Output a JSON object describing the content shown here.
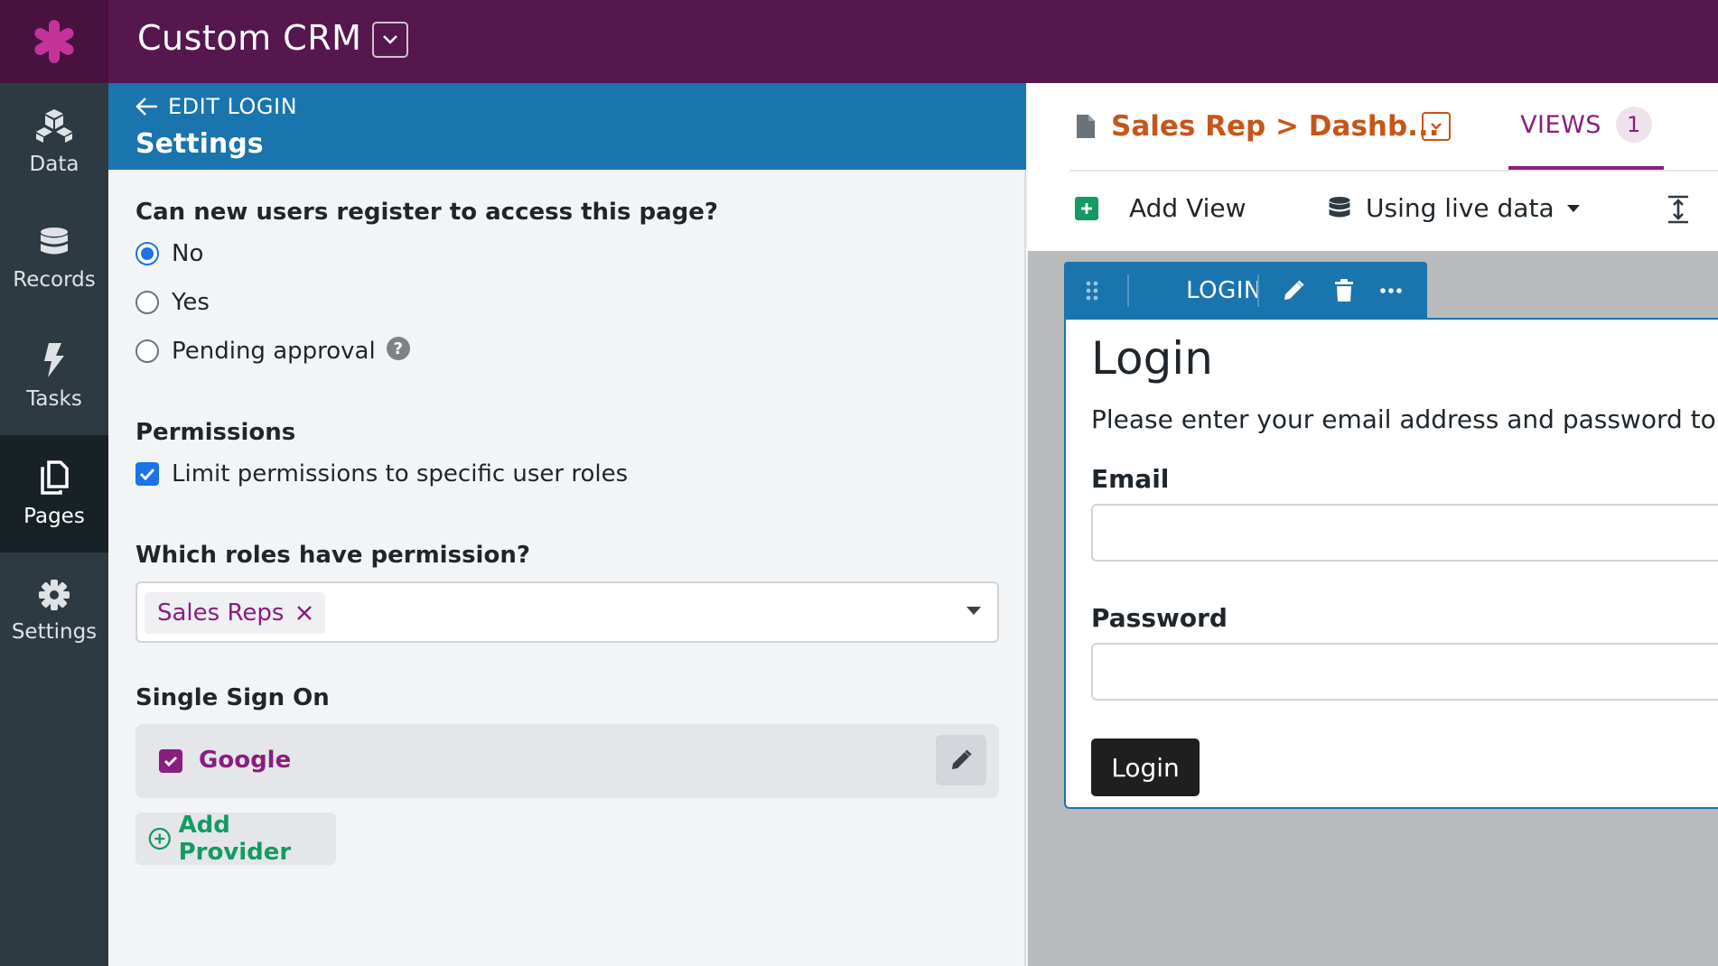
{
  "app": {
    "title": "Custom CRM"
  },
  "sidenav": {
    "items": [
      {
        "label": "Data",
        "icon": "cubes-icon"
      },
      {
        "label": "Records",
        "icon": "database-icon"
      },
      {
        "label": "Tasks",
        "icon": "bolt-icon"
      },
      {
        "label": "Pages",
        "icon": "pages-icon",
        "active": true
      },
      {
        "label": "Settings",
        "icon": "gear-icon"
      }
    ]
  },
  "settings_panel": {
    "back_label": "EDIT LOGIN",
    "title": "Settings",
    "registration": {
      "question": "Can new users register to access this page?",
      "options": [
        "No",
        "Yes",
        "Pending approval"
      ],
      "selected": "No"
    },
    "permissions": {
      "heading": "Permissions",
      "limit_label": "Limit permissions to specific user roles",
      "limit_checked": true
    },
    "roles": {
      "question": "Which roles have permission?",
      "selected_tags": [
        "Sales Reps"
      ]
    },
    "sso": {
      "heading": "Single Sign On",
      "providers": [
        {
          "name": "Google",
          "enabled": true
        }
      ],
      "add_label": "Add Provider"
    }
  },
  "page_header": {
    "crumb": "Sales Rep > Dashb...",
    "views_label": "VIEWS",
    "views_count": "1",
    "add_view_label": "Add View",
    "data_mode_label": "Using live data"
  },
  "view_toolbar": {
    "label": "LOGIN"
  },
  "login_view": {
    "title": "Login",
    "description": "Please enter your email address and password to login",
    "email_label": "Email",
    "password_label": "Password",
    "button_label": "Login"
  },
  "colors": {
    "topbar": "#55174d",
    "sidenav": "#2d3a42",
    "panel_header": "#1a74ad",
    "accent_purple": "#8a1d7d",
    "accent_orange": "#c7551a",
    "accent_green": "#159a63",
    "checkbox_blue": "#1a73e8"
  }
}
